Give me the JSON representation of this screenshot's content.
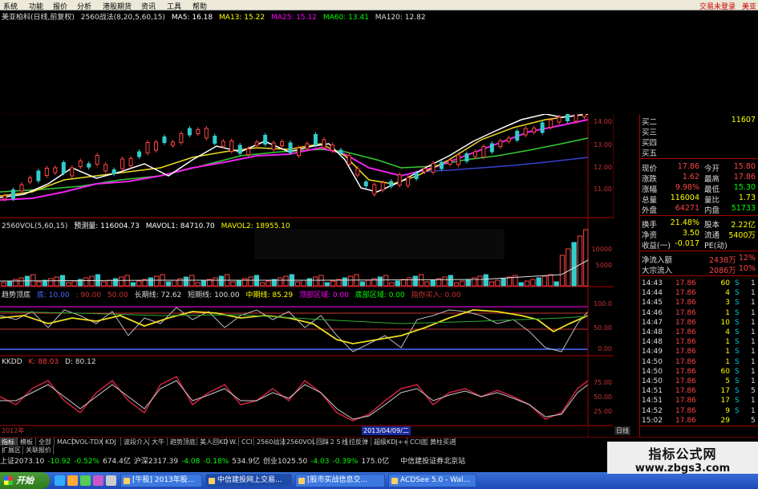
{
  "menu": {
    "items": [
      "系统",
      "功能",
      "报价",
      "分析",
      "港股期货",
      "资讯",
      "工具",
      "帮助"
    ],
    "login_status": "交易未登录",
    "right_label": "美亚"
  },
  "main_chart": {
    "title": "美亚柏科(日线,前复权)",
    "indicator": "2560战法(8,20,5,60,15)",
    "ma": [
      {
        "label": "MA5: 16.18",
        "color": "#ffffff"
      },
      {
        "label": "MA13: 15.22",
        "color": "#ffff00"
      },
      {
        "label": "MA25: 15.12",
        "color": "#ff00ff"
      },
      {
        "label": "MA60: 13.41",
        "color": "#00ff00"
      },
      {
        "label": "MA120: 12.82",
        "color": "#dddddd"
      }
    ],
    "y_ticks": [
      "14.00",
      "13.00",
      "12.00",
      "11.00"
    ]
  },
  "volume": {
    "title": "2560VOL(5,60,15)",
    "fields": [
      "预测量: 116004.73",
      "MAVOL1: 84710.70",
      "MAVOL2: 18955.10"
    ],
    "y_ticks": [
      "10000",
      "5000"
    ]
  },
  "trend": {
    "title": "趋势顶底",
    "fields": [
      {
        "label": "底: 10.00",
        "color": "#4a6aff"
      },
      {
        "label": ": 90.00",
        "color": "#c33"
      },
      {
        "label": "50.00",
        "color": "#c33"
      },
      {
        "label": "长期线: 72.62",
        "color": "#ddd"
      },
      {
        "label": "短期线: 100.00",
        "color": "#ddd"
      },
      {
        "label": "中期线: 85.29",
        "color": "#ffff00"
      },
      {
        "label": "顶部区域: 0.00",
        "color": "#ff00ff"
      },
      {
        "label": "底部区域: 0.00",
        "color": "#00ff00"
      },
      {
        "label": "指你买入: 0.00",
        "color": "#c33"
      }
    ],
    "y_ticks": [
      "100.0",
      "50.00",
      "0.00"
    ]
  },
  "kkdd": {
    "title": "KKDD",
    "fields": [
      {
        "label": "K: 88.03",
        "color": "#ff3b3b"
      },
      {
        "label": "D: 80.12",
        "color": "#ddd"
      }
    ],
    "y_ticks": [
      "75.00",
      "50.00",
      "25.00"
    ],
    "date_year": "2012年",
    "date_cursor": "2013/04/09/二"
  },
  "quote": {
    "bids": [
      {
        "label": "买二",
        "value": "",
        "vol": "11607"
      },
      {
        "label": "买三",
        "value": "",
        "vol": ""
      },
      {
        "label": "买四",
        "value": "",
        "vol": ""
      },
      {
        "label": "买五",
        "value": "",
        "vol": ""
      }
    ],
    "stats": [
      {
        "l1": "现价",
        "v1": "17.86",
        "l2": "今开",
        "v2": "15.80"
      },
      {
        "l1": "涨跌",
        "v1": "1.62",
        "l2": "最高",
        "v2": "17.86"
      },
      {
        "l1": "涨幅",
        "v1": "9.98%",
        "l2": "最低",
        "v2": "15.30"
      },
      {
        "l1": "总量",
        "v1": "116004",
        "l2": "量比",
        "v2": "1.73"
      },
      {
        "l1": "外盘",
        "v1": "64271",
        "l2": "内盘",
        "v2": "51733"
      }
    ],
    "stats2": [
      {
        "l1": "换手",
        "v1": "21.48%",
        "l2": "股本",
        "v2": "2.22亿"
      },
      {
        "l1": "净资",
        "v1": "3.50",
        "l2": "流通",
        "v2": "5400万"
      },
      {
        "l1": "收益(一)",
        "v1": "-0.017",
        "l2": "PE(动)",
        "v2": ""
      }
    ],
    "flows": [
      {
        "label": "净流入额",
        "amount": "2438万",
        "pct": "12%"
      },
      {
        "label": "大宗流入",
        "amount": "2086万",
        "pct": "10%"
      }
    ],
    "ticks": [
      {
        "t": "14:43",
        "p": "17.86",
        "v": "60",
        "s": "S",
        "n": "1"
      },
      {
        "t": "14:44",
        "p": "17.86",
        "v": "4",
        "s": "S",
        "n": "1"
      },
      {
        "t": "14:45",
        "p": "17.86",
        "v": "3",
        "s": "S",
        "n": "1"
      },
      {
        "t": "14:46",
        "p": "17.86",
        "v": "1",
        "s": "S",
        "n": "1"
      },
      {
        "t": "14:47",
        "p": "17.86",
        "v": "10",
        "s": "S",
        "n": "1"
      },
      {
        "t": "14:48",
        "p": "17.86",
        "v": "4",
        "s": "S",
        "n": "1"
      },
      {
        "t": "14:48",
        "p": "17.86",
        "v": "1",
        "s": "S",
        "n": "1"
      },
      {
        "t": "14:49",
        "p": "17.86",
        "v": "1",
        "s": "S",
        "n": "1"
      },
      {
        "t": "14:50",
        "p": "17.86",
        "v": "1",
        "s": "S",
        "n": "1"
      },
      {
        "t": "14:50",
        "p": "17.86",
        "v": "60",
        "s": "S",
        "n": "1"
      },
      {
        "t": "14:50",
        "p": "17.86",
        "v": "5",
        "s": "S",
        "n": "1"
      },
      {
        "t": "14:51",
        "p": "17.86",
        "v": "17",
        "s": "S",
        "n": "5"
      },
      {
        "t": "14:51",
        "p": "17.86",
        "v": "17",
        "s": "S",
        "n": "1"
      },
      {
        "t": "14:52",
        "p": "17.86",
        "v": "9",
        "s": "S",
        "n": "1"
      },
      {
        "t": "15:02",
        "p": "17.86",
        "v": "29",
        "s": "",
        "n": "5"
      }
    ],
    "period_tab": "日线"
  },
  "tabs": [
    "指标",
    "模板",
    "全部",
    "MACD",
    "VOL-TDX",
    "KDJ",
    "波段介入",
    "大牛",
    "趋势顶底",
    "美人回KD",
    "W.",
    "CCI",
    "2560战法",
    "2560VOL",
    "回踩２５线",
    "拉反弹",
    "超级KDJ++",
    "CCI底",
    "黄柱买进"
  ],
  "tabs2": [
    "扩展区",
    "关联报价"
  ],
  "status": [
    {
      "text": "上证2073.10",
      "color": "#ddd"
    },
    {
      "text": "-10.92",
      "color": "#0f0"
    },
    {
      "text": "-0.52%",
      "color": "#0f0"
    },
    {
      "text": "674.4亿",
      "color": "#ddd"
    },
    {
      "text": "沪深2317.39",
      "color": "#ddd"
    },
    {
      "text": "-4.08",
      "color": "#0f0"
    },
    {
      "text": "-0.18%",
      "color": "#0f0"
    },
    {
      "text": "534.9亿",
      "color": "#ddd"
    },
    {
      "text": "创业1025.50",
      "color": "#ddd"
    },
    {
      "text": "-4.03",
      "color": "#0f0"
    },
    {
      "text": "-0.39%",
      "color": "#0f0"
    },
    {
      "text": "175.0亿",
      "color": "#ddd"
    },
    {
      "text": "中信建投证券北京站",
      "color": "#ddd"
    }
  ],
  "watermark": {
    "line1": "指标公式网",
    "line2": "www.zbgs3.com"
  },
  "taskbar": {
    "start": "开始",
    "buttons": [
      "[牛股] 2013年股...",
      "中信建投网上交易...",
      "[股市实战信息交...",
      "ACDSee 5.0 - Wal..."
    ]
  }
}
